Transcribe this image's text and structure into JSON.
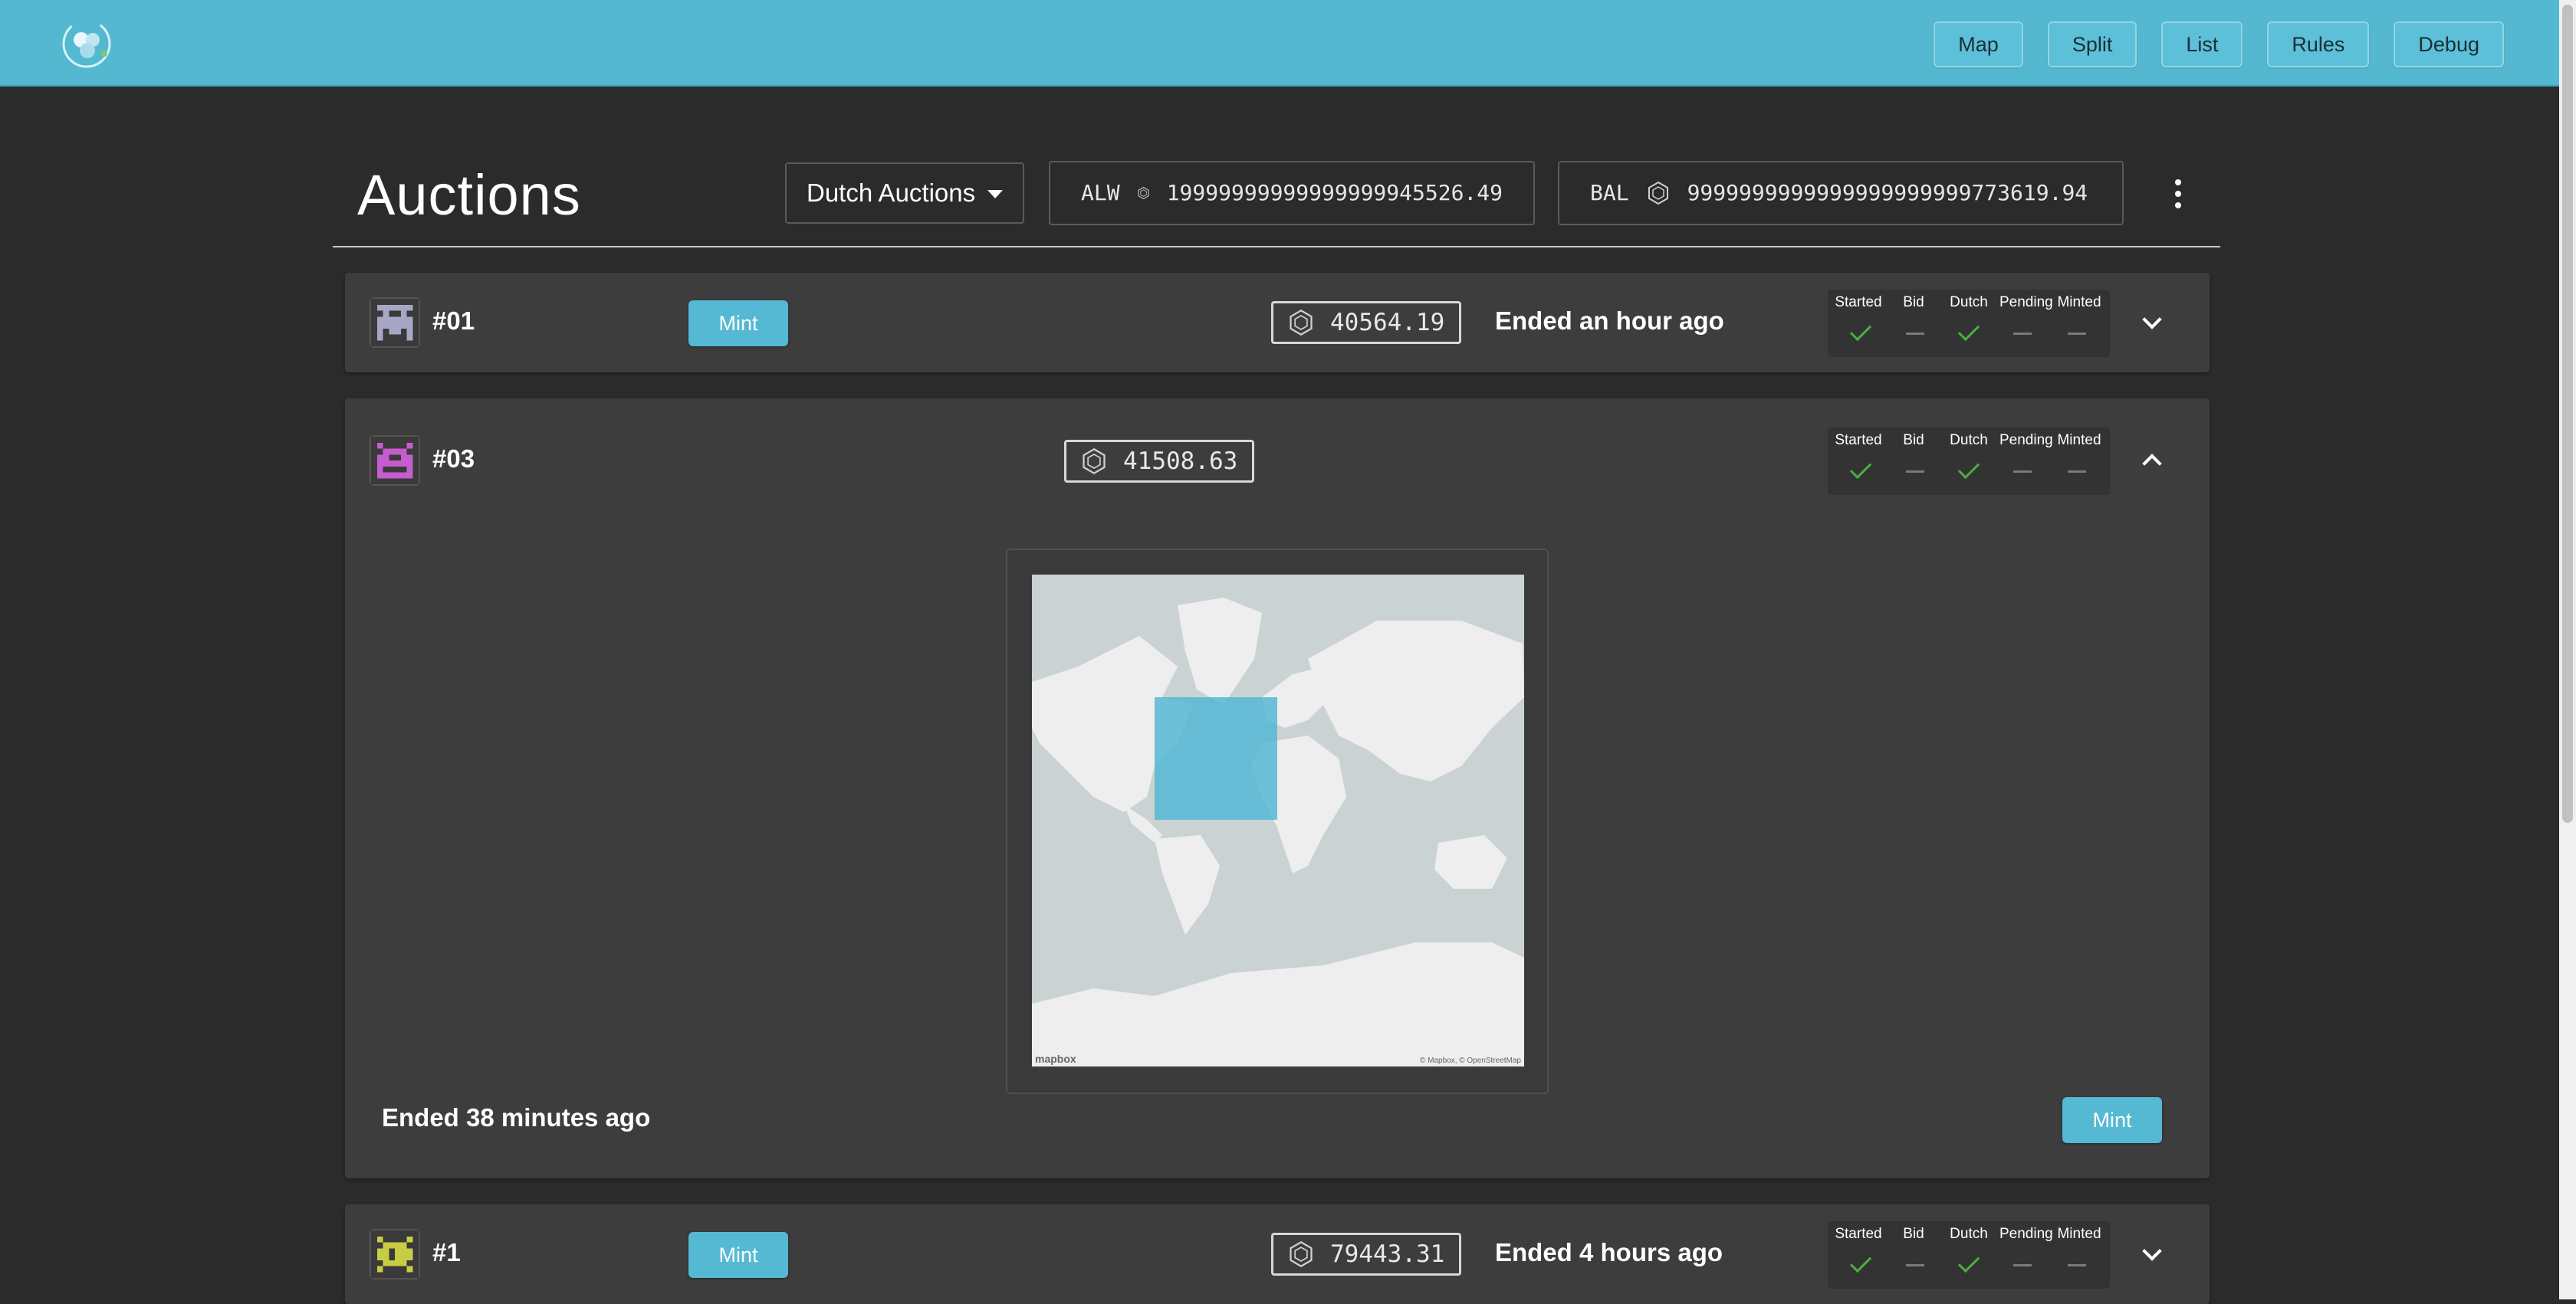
{
  "nav": {
    "items": [
      "Map",
      "Split",
      "List",
      "Rules",
      "Debug"
    ]
  },
  "header": {
    "title": "Auctions",
    "filter": "Dutch Auctions",
    "balances": [
      {
        "symbol": "ALW",
        "amount": "19999999999999999945526.49"
      },
      {
        "symbol": "BAL",
        "amount": "9999999999999999999999773619.94"
      }
    ]
  },
  "status_headers": [
    "Started",
    "Bid",
    "Dutch",
    "Pending",
    "Minted"
  ],
  "auctions": [
    {
      "name": "#01",
      "mint_label": "Mint",
      "price": "40564.19",
      "ended": "Ended an hour ago",
      "status": [
        true,
        false,
        true,
        false,
        false
      ],
      "expanded": false,
      "token_color": "#a7a7c4"
    },
    {
      "name": "#03",
      "mint_label": "Mint",
      "price": "41508.63",
      "ended": "Ended 38 minutes ago",
      "status": [
        true,
        false,
        true,
        false,
        false
      ],
      "expanded": true,
      "token_color": "#c55ccf",
      "map": {
        "logo": "mapbox",
        "attribution": "© Mapbox, © OpenStreetMap"
      }
    },
    {
      "name": "#1",
      "mint_label": "Mint",
      "price": "79443.31",
      "ended": "Ended 4 hours ago",
      "status": [
        true,
        false,
        true,
        false,
        false
      ],
      "expanded": false,
      "token_color": "#c8cc45"
    }
  ],
  "colors": {
    "header_bg": "#54b8d1",
    "page_bg": "#2b2b2b",
    "card_bg": "#3d3d3d",
    "accent": "#55b9d3",
    "check": "#4caf3f"
  }
}
